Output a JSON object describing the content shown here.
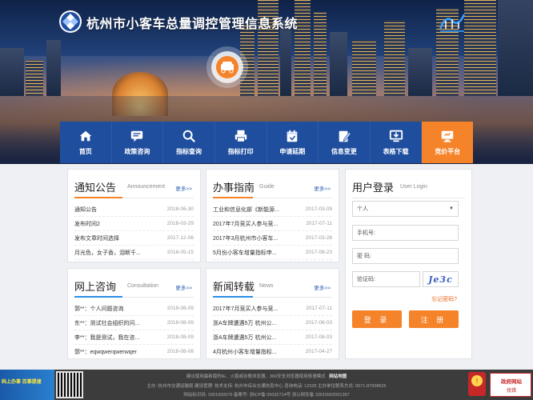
{
  "header": {
    "title": "杭州市小客车总量调控管理信息系统"
  },
  "nav": [
    {
      "label": "首页",
      "icon": "home-icon"
    },
    {
      "label": "政策咨询",
      "icon": "chat-icon"
    },
    {
      "label": "指标查询",
      "icon": "search-icon"
    },
    {
      "label": "指标打印",
      "icon": "print-icon"
    },
    {
      "label": "申请延期",
      "icon": "calendar-icon"
    },
    {
      "label": "信息变更",
      "icon": "edit-icon"
    },
    {
      "label": "表格下载",
      "icon": "download-icon"
    },
    {
      "label": "竞价平台",
      "icon": "monitor-icon",
      "active": true
    }
  ],
  "notices": {
    "title": "通知公告",
    "subtitle": "Announcement",
    "more": "更多>>",
    "items": [
      {
        "text": "通知公告",
        "date": "2018-06-30"
      },
      {
        "text": "发布时间2",
        "date": "2018-03-29"
      },
      {
        "text": "发布文章时间选择",
        "date": "2017-12-06"
      },
      {
        "text": "月光色，女子香，泪断千...",
        "date": "2018-05-15"
      }
    ]
  },
  "guide": {
    "title": "办事指南",
    "subtitle": "Guide",
    "more": "更多>>",
    "items": [
      {
        "text": "工业和信息化部《新能源...",
        "date": "2017-03-09"
      },
      {
        "text": "2017年7月竞买人参与竞...",
        "date": "2017-07-11"
      },
      {
        "text": "2017年3月杭州市小客车...",
        "date": "2017-03-28"
      },
      {
        "text": "5月份小客车增量指标申...",
        "date": "2017-08-23"
      }
    ]
  },
  "consult": {
    "title": "网上咨询",
    "subtitle": "Consultation",
    "more": "更多>>",
    "items": [
      {
        "text": "郭**：个人问题咨询",
        "date": "2018-08-09"
      },
      {
        "text": "东**：测试社会组织的问...",
        "date": "2018-08-09"
      },
      {
        "text": "李**：我是测试，我在咨...",
        "date": "2018-08-09"
      },
      {
        "text": "郭**：eqwqwerqwerwqer",
        "date": "2018-08-08"
      }
    ]
  },
  "news": {
    "title": "新闻转载",
    "subtitle": "News",
    "more": "更多>>",
    "items": [
      {
        "text": "2017年7月竞买人参与竞...",
        "date": "2017-07-11"
      },
      {
        "text": "浙A车牌遭遇5万 杭州公...",
        "date": "2017-08-03"
      },
      {
        "text": "浙A车牌遭遇5万 杭州公...",
        "date": "2017-08-03"
      },
      {
        "text": "4月杭州小客车增量指标...",
        "date": "2017-04-27"
      }
    ]
  },
  "login": {
    "title": "用户登录",
    "subtitle": "User Login",
    "user_type": "个人",
    "phone_placeholder": "手机号:",
    "password_placeholder": "密  码:",
    "captcha_placeholder": "验证码:",
    "captcha_text": "Je3c",
    "forgot": "忘记密码?",
    "login_btn": "登 录",
    "register_btn": "注 册"
  },
  "footer": {
    "line1": "建议使用最新版的IE、火狐或谷歌浏览器、360安全浏览器使用极速模式",
    "sitemap": "网站地图",
    "line2": "主办: 杭州市交通运输局 建设管理: 技术支持: 杭州市综合交通信息中心 咨询电话: 12328 主办单位联系方式: 0571-87008625",
    "line3": "网站标识码: 3301000076   备案号: 浙ICP备 05032714号   浙公网安备 33010502001397",
    "banner": "码上办事 百事提速",
    "qr_label": "",
    "gov_a": "政府网站",
    "gov_b": "找错"
  },
  "colors": {
    "nav_bg": "#1f4e9e",
    "accent": "#f5832a",
    "link": "#2b5fb3"
  }
}
